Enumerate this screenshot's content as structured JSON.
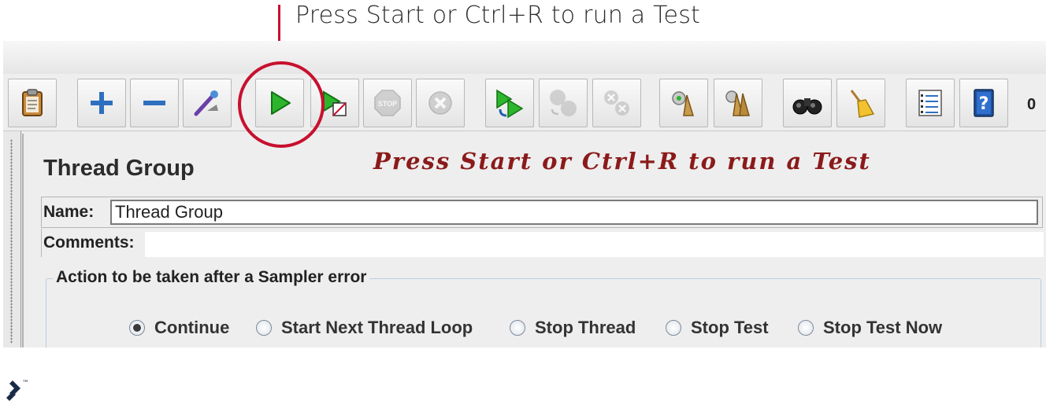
{
  "caption": "Press Start or Ctrl+R to run a Test",
  "accent_color": "#c8102e",
  "toolbar": {
    "buttons": [
      {
        "icon": "clipboard-icon",
        "enabled": true
      },
      {
        "icon": "expand-plus-icon",
        "enabled": true
      },
      {
        "icon": "collapse-minus-icon",
        "enabled": true
      },
      {
        "icon": "toggle-wand-icon",
        "enabled": true
      },
      {
        "icon": "start-icon",
        "enabled": true
      },
      {
        "icon": "start-no-pauses-icon",
        "enabled": true
      },
      {
        "icon": "stop-icon",
        "enabled": false
      },
      {
        "icon": "shutdown-icon",
        "enabled": false
      },
      {
        "icon": "remote-start-icon",
        "enabled": true
      },
      {
        "icon": "remote-stop-icon",
        "enabled": false
      },
      {
        "icon": "remote-shutdown-icon",
        "enabled": false
      },
      {
        "icon": "clear-icon",
        "enabled": true
      },
      {
        "icon": "clear-all-icon",
        "enabled": true
      },
      {
        "icon": "search-binoculars-icon",
        "enabled": true
      },
      {
        "icon": "reset-search-broom-icon",
        "enabled": true
      },
      {
        "icon": "function-helper-list-icon",
        "enabled": true
      },
      {
        "icon": "help-icon",
        "enabled": true
      }
    ],
    "active_threads": "0"
  },
  "panel": {
    "title": "Thread Group",
    "script_note": "Press Start or Ctrl+R to run a Test",
    "name_label": "Name:",
    "name_value": "Thread Group",
    "comments_label": "Comments:",
    "comments_value": ""
  },
  "error_action": {
    "legend": "Action to be taken after a Sampler error",
    "options": [
      {
        "label": "Continue",
        "selected": true
      },
      {
        "label": "Start Next Thread Loop",
        "selected": false
      },
      {
        "label": "Stop Thread",
        "selected": false
      },
      {
        "label": "Stop Test",
        "selected": false
      },
      {
        "label": "Stop Test Now",
        "selected": false
      }
    ]
  },
  "logo_mark": "™"
}
